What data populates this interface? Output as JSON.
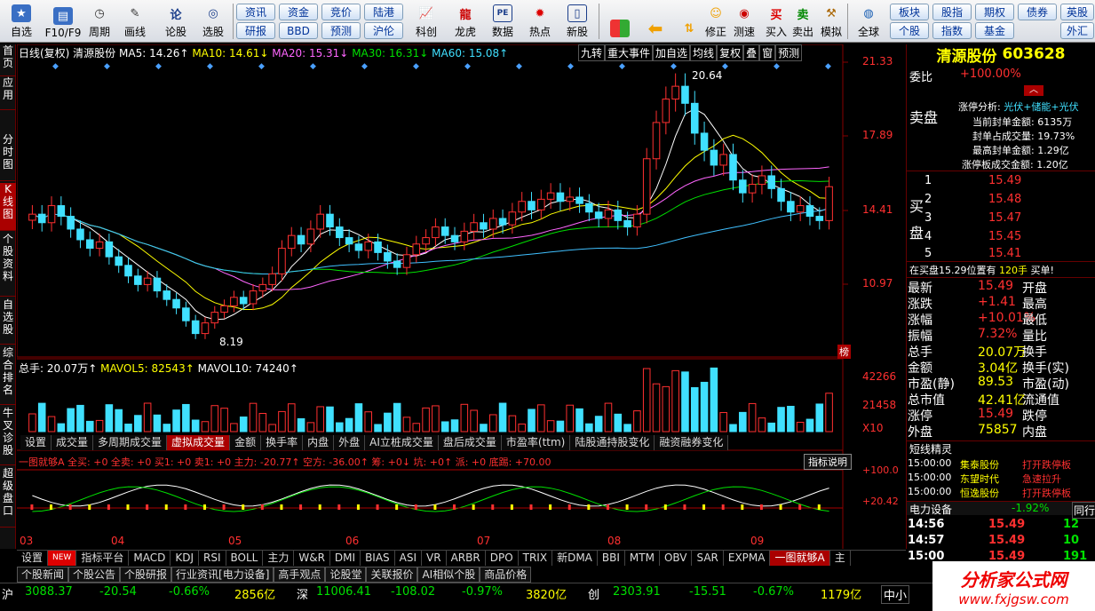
{
  "toolbar": {
    "buttons": [
      {
        "label": "自选",
        "icon": "star-icon"
      },
      {
        "label": "F10/F9",
        "icon": "f10-icon"
      },
      {
        "label": "周期",
        "icon": "clock-icon"
      },
      {
        "label": "画线",
        "icon": "pen-icon"
      },
      {
        "label": "论股",
        "icon": "discuss-icon"
      },
      {
        "label": "选股",
        "icon": "search-chart-icon"
      }
    ],
    "pills_top": [
      "资讯",
      "资金",
      "竞价",
      "陆港"
    ],
    "pills_bottom": [
      "研报",
      "BBD",
      "预测",
      "沪伦"
    ],
    "buttons2": [
      {
        "label": "科创"
      },
      {
        "label": "龙虎"
      },
      {
        "label": "数据"
      },
      {
        "label": "热点"
      },
      {
        "label": "新股"
      }
    ],
    "buttons3": [
      {
        "label": ""
      },
      {
        "label": ""
      },
      {
        "label": "修正"
      },
      {
        "label": "测速"
      },
      {
        "label": "买入"
      },
      {
        "label": "卖出"
      },
      {
        "label": "模拟"
      }
    ],
    "global": "全球",
    "pills2_top": [
      "板块",
      "股指",
      "期权",
      "债券",
      "英股"
    ],
    "pills2_bottom": [
      "个股",
      "指数",
      "基金",
      "外汇"
    ]
  },
  "lefttabs": [
    "首页",
    "应用",
    "分时图",
    "K线图",
    "个股资料",
    "自选股",
    "综合排名",
    "牛叉诊股",
    "超级盘口"
  ],
  "main": {
    "info_line": "日线(复权) 清源股份",
    "ma5": "MA5: 14.26↑",
    "ma10": "MA10: 14.61↓",
    "ma20": "MA20: 15.31↓",
    "ma30": "MA30: 16.31↓",
    "ma60": "MA60: 15.08↑",
    "top_tools": [
      "九转",
      "重大事件",
      "加自选",
      "均线",
      "复权",
      "叠",
      "窗",
      "预测"
    ],
    "price_axis": [
      "21.33",
      "17.89",
      "14.41",
      "10.97"
    ],
    "high_label": "20.64",
    "low_label": "8.19",
    "bang": "榜",
    "vol_line": "总手: 20.07万↑",
    "mavol5": "MAVOL5: 82543↑",
    "mavol10": "MAVOL10: 74240↑",
    "vol_axis": [
      "42266",
      "21458",
      "X10"
    ],
    "sub_tabs": [
      "设置",
      "成交量",
      "多周期成交量",
      "虚拟成交量",
      "金额",
      "换手率",
      "内盘",
      "外盘",
      "AI立桩成交量",
      "盘后成交量",
      "市盈率(ttm)",
      "陆股通持股变化",
      "融资融券变化"
    ],
    "sub_active": "虚拟成交量",
    "ind_line": "一图就够A 全买: +0 全卖: +0 买1: +0 卖1: +0 主力: -20.77↑ 空方: -36.00↑ 筹: +0↓ 坑: +0↑ 派: +0 底踢: +70.00",
    "ind_btn": "指标说明",
    "ind_axis": [
      "+100.0",
      "+20.42"
    ],
    "months": [
      "03",
      "04",
      "05",
      "06",
      "07",
      "08",
      "09"
    ]
  },
  "bottom_tabs": [
    "设置",
    "NEW",
    "指标平台",
    "MACD",
    "KDJ",
    "RSI",
    "BOLL",
    "主力",
    "W&R",
    "DMI",
    "BIAS",
    "ASI",
    "VR",
    "ARBR",
    "DPO",
    "TRIX",
    "新DMA",
    "BBI",
    "MTM",
    "OBV",
    "SAR",
    "EXPMA",
    "一图就够A",
    "主"
  ],
  "bottom_active": "一图就够A",
  "news": [
    "个股新闻",
    "个股公告",
    "个股研报",
    "行业资讯[电力设备]",
    "高手观点",
    "论股堂",
    "关联报价",
    "AI相似个股",
    "商品价格"
  ],
  "right": {
    "name": "清源股份",
    "code": "603628",
    "weibi_label": "委比",
    "weibi": "+100.00%",
    "zt_title": "涨停分析:",
    "zt_tags": "光伏+储能+光伏",
    "zt_rows": [
      "当前封单金额: 6135万",
      "封单占成交量: 19.73%",
      "最高封单金额: 1.29亿",
      "涨停板成交金额: 1.20亿"
    ],
    "sell_label": "卖盘",
    "buy_label": "买盘",
    "buy_levels": [
      {
        "n": "1",
        "p": "15.49"
      },
      {
        "n": "2",
        "p": "15.48"
      },
      {
        "n": "3",
        "p": "15.47"
      },
      {
        "n": "4",
        "p": "15.45"
      },
      {
        "n": "5",
        "p": "15.41"
      }
    ],
    "queue": "在买盘15.29位置有",
    "queue_vol": "120手",
    "queue_act": "买单!",
    "stats": [
      {
        "k": "最新",
        "v": "15.49",
        "k2": "开盘",
        "v2": ""
      },
      {
        "k": "涨跌",
        "v": "+1.41",
        "k2": "最高",
        "v2": ""
      },
      {
        "k": "涨幅",
        "v": "+10.01%",
        "k2": "最低",
        "v2": ""
      },
      {
        "k": "振幅",
        "v": "7.32%",
        "k2": "量比",
        "v2": ""
      },
      {
        "k": "总手",
        "v": "20.07万",
        "k2": "换手",
        "v2": ""
      },
      {
        "k": "金额",
        "v": "3.04亿",
        "k2": "换手(实)",
        "v2": ""
      },
      {
        "k": "市盈(静)",
        "v": "89.53",
        "k2": "市盈(动)",
        "v2": ""
      },
      {
        "k": "总市值",
        "v": "42.41亿",
        "k2": "流通值",
        "v2": ""
      },
      {
        "k": "涨停",
        "v": "15.49",
        "k2": "跌停",
        "v2": ""
      },
      {
        "k": "外盘",
        "v": "75857",
        "k2": "内盘",
        "v2": ""
      }
    ],
    "short_title": "短线精灵",
    "short_rows": [
      {
        "t": "15:00:00",
        "n": "集泰股份",
        "e": "打开跌停板"
      },
      {
        "t": "15:00:00",
        "n": "东望时代",
        "e": "急速拉升"
      },
      {
        "t": "15:00:00",
        "n": "恒逸股份",
        "e": "打开跌停板"
      }
    ],
    "sector": "电力设备",
    "sector_pct": "-1.92%",
    "sector_tab": "同行",
    "ticks": [
      {
        "t": "14:56",
        "p": "15.49",
        "v": "12"
      },
      {
        "t": "14:57",
        "p": "15.49",
        "v": "10"
      },
      {
        "t": "15:00",
        "p": "15.49",
        "v": "191"
      }
    ]
  },
  "status": {
    "sh": "沪",
    "sh_idx": "3088.37",
    "sh_chg": "-20.54",
    "sh_pct": "-0.66%",
    "sh_amt": "2856亿",
    "sz": "深",
    "sz_idx": "11006.41",
    "sz_chg": "-108.02",
    "sz_pct": "-0.97%",
    "sz_amt": "3820亿",
    "cy": "创",
    "cy_idx": "2303.91",
    "cy_chg": "-15.51",
    "cy_pct": "-0.67%",
    "cy_amt": "1179亿",
    "mid": "中小"
  },
  "logo": {
    "cn": "分析家公式网",
    "url": "www.fxjgsw.com"
  },
  "chart_data": {
    "type": "candlestick",
    "price_high": 20.64,
    "price_low": 8.19,
    "price_ticks": [
      21.33,
      17.89,
      14.41,
      10.97
    ],
    "closes": [
      14.2,
      13.8,
      14.6,
      14.1,
      13.5,
      13.0,
      12.6,
      12.9,
      12.2,
      11.8,
      11.3,
      10.9,
      11.2,
      10.6,
      10.2,
      9.8,
      9.2,
      8.6,
      9.1,
      9.6,
      9.9,
      10.3,
      10.0,
      10.6,
      10.9,
      11.4,
      12.6,
      13.2,
      12.8,
      13.5,
      14.2,
      13.6,
      13.1,
      12.8,
      12.5,
      12.9,
      12.4,
      12.0,
      11.7,
      12.3,
      12.8,
      13.1,
      13.6,
      13.2,
      12.9,
      13.4,
      13.8,
      13.5,
      14.0,
      13.7,
      14.3,
      14.8,
      14.4,
      14.9,
      15.2,
      14.8,
      15.0,
      14.7,
      14.3,
      14.0,
      14.4,
      13.9,
      13.6,
      14.2,
      16.8,
      18.5,
      19.6,
      20.2,
      19.4,
      18.0,
      17.2,
      16.5,
      17.0,
      15.8,
      15.2,
      15.6,
      16.0,
      15.4,
      14.8,
      14.3,
      14.6,
      14.1,
      13.9,
      15.49
    ],
    "volume_ticks": [
      42266,
      21458
    ],
    "volume_note": "X10"
  }
}
